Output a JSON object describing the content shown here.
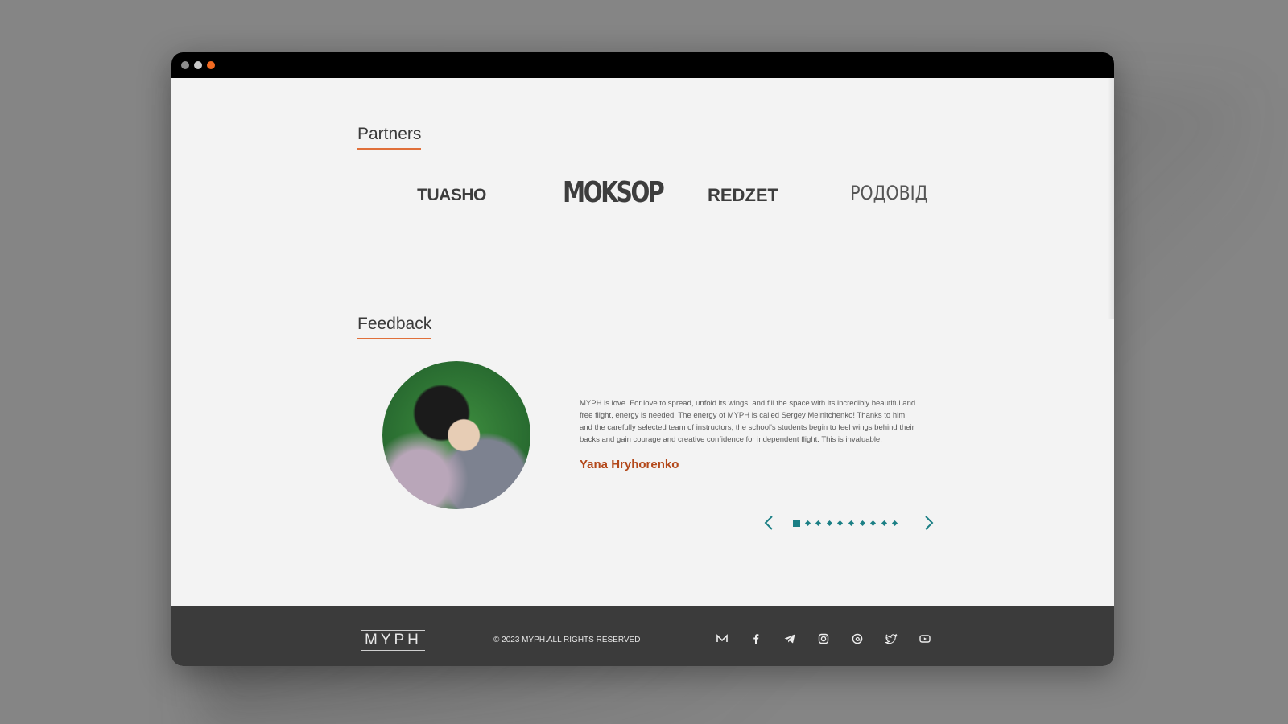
{
  "window": {
    "controls": [
      "close-dot",
      "minimize-dot",
      "maximize-dot"
    ]
  },
  "partners": {
    "title": "Partners",
    "logos": [
      "TUASHO",
      "MOKSOP",
      "REDZET",
      "РОДОВІД"
    ]
  },
  "feedback": {
    "title": "Feedback",
    "quote": "MYPH is love. For love to spread, unfold its wings, and fill the space with its incredibly beautiful and free flight, energy is needed. The energy of MYPH is called Sergey Melnitchenko! Thanks to him and the carefully selected team of instructors, the school's students begin to feel wings behind their backs and gain courage and creative confidence for independent flight. This is invaluable.",
    "author": "Yana Hryhorenko",
    "pager": {
      "count": 10,
      "active": 0
    }
  },
  "footer": {
    "brand": "MYPH",
    "copyright": "© 2023 MYPH.ALL RIGHTS RESERVED",
    "social_icons": [
      "mail-icon",
      "facebook-icon",
      "telegram-icon",
      "instagram-icon",
      "threads-icon",
      "twitter-icon",
      "youtube-icon"
    ]
  },
  "colors": {
    "accent_orange": "#e0703a",
    "author": "#b3481a",
    "pager": "#1b7f85",
    "footer_bg": "#3b3b3b"
  }
}
